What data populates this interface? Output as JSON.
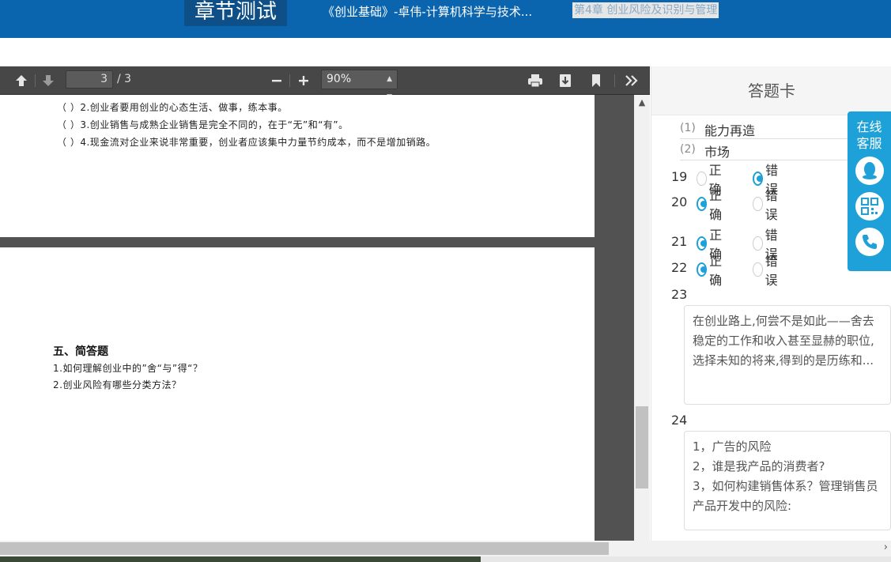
{
  "header": {
    "title": "章节测试",
    "course": "《创业基础》-卓伟-计算机科学与技术...",
    "chapter": "第4章 创业风险及识别与管理"
  },
  "pdf": {
    "page_current": "3",
    "page_total": "/ 3",
    "zoom": "90%",
    "page_a_lines": [
      "（   ）2.创业者要用创业的心态生活、做事，练本事。",
      "（   ）3.创业销售与成熟企业销售是完全不同的，在于“无”和“有”。",
      "（   ）4.现金流对企业来说非常重要，创业者应该集中力量节约成本，而不是增加销路。"
    ],
    "page_b": {
      "section_title": "五、简答题",
      "questions": [
        "1.如何理解创业中的”舍“与”得“？",
        "2.创业风险有哪些分类方法？"
      ]
    }
  },
  "answer_card": {
    "title": "答题卡",
    "fills": [
      {
        "num": "(1)",
        "value": "能力再造"
      },
      {
        "num": "(2)",
        "value": "市场"
      }
    ],
    "tf_label_true": "正确",
    "tf_label_false": "错误",
    "tf": [
      {
        "num": "19",
        "answer": "错误"
      },
      {
        "num": "20",
        "answer": "正确"
      },
      {
        "num": "21",
        "answer": "正确"
      },
      {
        "num": "22",
        "answer": "正确"
      }
    ],
    "essays": [
      {
        "num": "23",
        "text": "在创业路上,何尝不是如此——舍去稳定的工作和收入甚至显赫的职位,选择未知的将来,得到的是历练和..."
      },
      {
        "num": "24",
        "text": "1，广告的风险\n2，谁是我产品的消费者?\n3，如何构建销售体系？管理销售员产品开发中的风险:"
      }
    ]
  },
  "service": {
    "label": "在线客服"
  },
  "colors": {
    "header_bg": "#0a64ae",
    "accent": "#1ea1d8",
    "toolbar_bg": "#474747"
  }
}
